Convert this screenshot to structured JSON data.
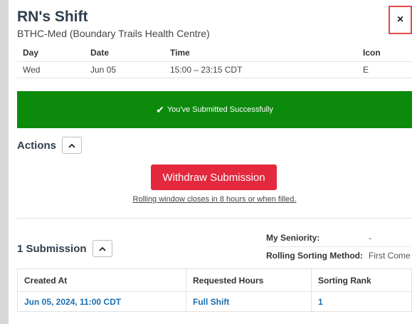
{
  "header": {
    "title": "RN's Shift",
    "subtitle": "BTHC-Med (Boundary Trails Health Centre)",
    "close_label": "×"
  },
  "shift_table": {
    "columns": [
      "Day",
      "Date",
      "Time",
      "Icon"
    ],
    "row": [
      "Wed",
      "Jun 05",
      "15:00 – 23:15 CDT",
      "E"
    ]
  },
  "banner": {
    "text": "You've Submitted Successfully",
    "color": "#0b8a0b"
  },
  "actions": {
    "label": "Actions",
    "withdraw_label": "Withdraw Submission",
    "withdraw_color": "#e4283d",
    "window_note": "Rolling window closes in 8 hours or when filled."
  },
  "submissions": {
    "label": "1 Submission",
    "seniority_label": "My Seniority:",
    "seniority_value": "-",
    "sorting_label": "Rolling Sorting Method:",
    "sorting_value": "First Come",
    "columns": [
      "Created At",
      "Requested Hours",
      "Sorting Rank"
    ],
    "rows": [
      [
        "Jun 05, 2024, 11:00 CDT",
        "Full Shift",
        "1"
      ]
    ]
  }
}
